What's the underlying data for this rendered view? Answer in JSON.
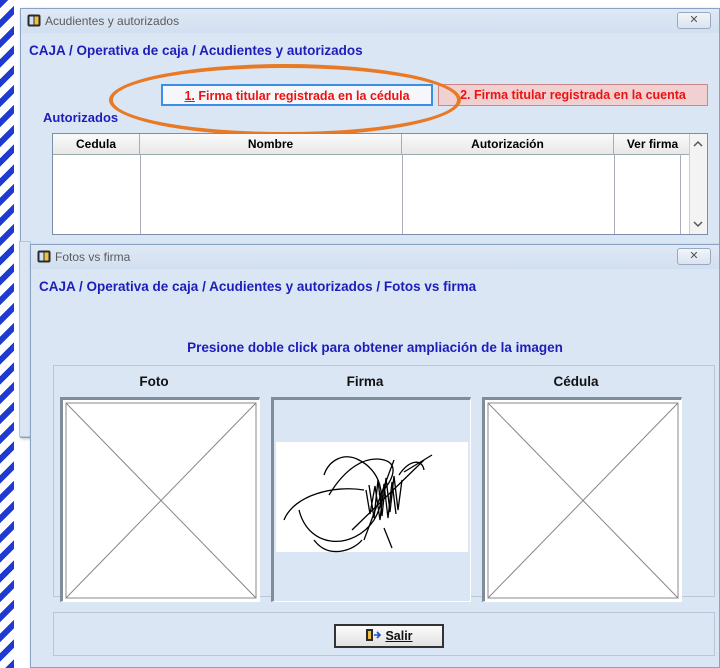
{
  "window1": {
    "title": "Acudientes y autorizados",
    "close_label": "✕",
    "breadcrumb": "CAJA / Operativa de caja / Acudientes y autorizados",
    "tabs": [
      {
        "number": "1.",
        "label": " Firma titular registrada en la cédula"
      },
      {
        "number": "2. ",
        "label": "Firma titular registrada en la cuenta"
      }
    ],
    "section_label": "Autorizados",
    "table": {
      "columns": [
        "Cedula",
        "Nombre",
        "Autorización",
        "Ver firma"
      ]
    }
  },
  "window2": {
    "title": "Fotos vs firma",
    "close_label": "✕",
    "breadcrumb": "CAJA / Operativa de caja / Acudientes y autorizados / Fotos vs firma",
    "hint": "Presione doble click para obtener ampliación de la imagen",
    "images": [
      {
        "label": "Foto"
      },
      {
        "label": "Firma"
      },
      {
        "label": "Cédula"
      }
    ],
    "exit_label": "Salir"
  },
  "icons": {
    "window": "app-window-icon",
    "exit": "exit-door-icon",
    "scroll_up": "chevron-up-icon",
    "scroll_down": "chevron-down-icon"
  },
  "colors": {
    "accent_blue": "#1d1dba",
    "tab_red": "#ee1111",
    "highlight_orange": "#e87a26"
  }
}
